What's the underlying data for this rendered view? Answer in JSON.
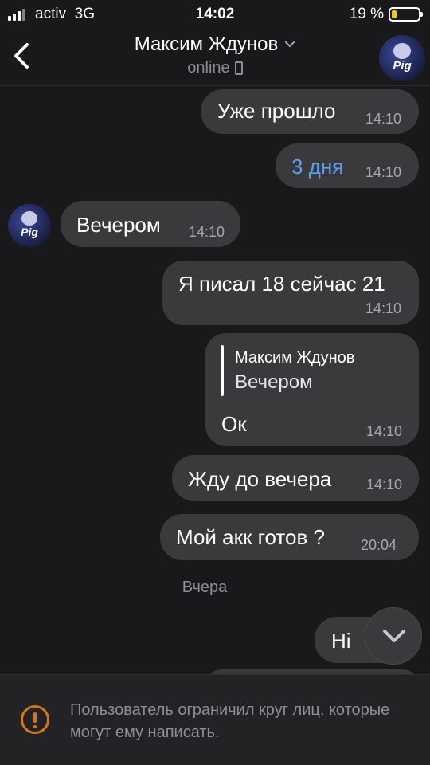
{
  "status_bar": {
    "carrier": "activ",
    "network": "3G",
    "time": "14:02",
    "battery": "19 %",
    "battery_level": 0.19
  },
  "header": {
    "contact_name": "Максим Ждунов",
    "presence": "online"
  },
  "messages": [
    {
      "text": "Уже прошло",
      "time": "14:10",
      "side": "out"
    },
    {
      "text": "3 дня",
      "time": "14:10",
      "side": "out",
      "link": true
    },
    {
      "text": "Вечером",
      "time": "14:10",
      "side": "in"
    },
    {
      "text": "Я писал 18 сейчас 21",
      "time": "14:10",
      "side": "out"
    },
    {
      "text": "Ок",
      "time": "14:10",
      "side": "out",
      "reply": {
        "name": "Максим Ждунов",
        "text": "Вечером"
      }
    },
    {
      "text": "Жду до вечера",
      "time": "14:10",
      "side": "out"
    },
    {
      "text": "Мой акк готов ?",
      "time": "20:04",
      "side": "out"
    },
    {
      "text": "Hi",
      "side": "out"
    }
  ],
  "day_separator": "Вчера",
  "avatar_label": "Pig",
  "restriction_notice": "Пользователь ограничил круг лиц, которые могут ему написать.",
  "colors": {
    "background": "#19191b",
    "bubble": "#3a3a3c",
    "link": "#5aa0f2",
    "warning": "#d2761c"
  }
}
